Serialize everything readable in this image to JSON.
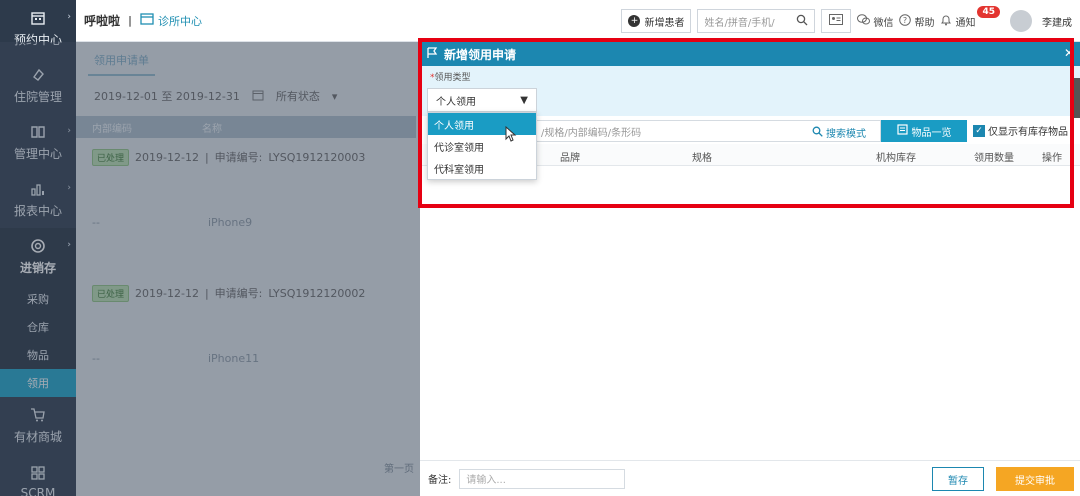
{
  "sidebar": {
    "items": [
      {
        "label": "预约中心",
        "icon": "calendar-icon"
      },
      {
        "label": "住院管理",
        "icon": "hospital-icon"
      },
      {
        "label": "管理中心",
        "icon": "book-icon"
      },
      {
        "label": "报表中心",
        "icon": "bar-chart-icon"
      },
      {
        "label": "进销存",
        "icon": "inventory-icon"
      },
      {
        "label": "有材商城",
        "icon": "cart-icon"
      },
      {
        "label": "SCRM",
        "icon": "grid-icon"
      }
    ],
    "subitems": [
      "采购",
      "仓库",
      "物品",
      "领用"
    ]
  },
  "topbar": {
    "brand": "呼啦啦",
    "separator": "|",
    "clinic": "诊所中心",
    "new_patient": "新增患者",
    "search_placeholder": "姓名/拼音/手机/",
    "wechat": "微信",
    "help": "帮助",
    "notify": "通知",
    "notify_count": "45",
    "username": "李建成"
  },
  "background": {
    "tab": "领用申请单",
    "date_range": "2019-12-01 至 2019-12-31",
    "status_filter": "所有状态",
    "col_code": "内部编码",
    "col_name": "名称",
    "groups": [
      {
        "tag": "已处理",
        "date": "2019-12-12",
        "sep": "|",
        "no_label": "申请编号:",
        "no": "LYSQ1912120003",
        "code": "--",
        "name": "iPhone9"
      },
      {
        "tag": "已处理",
        "date": "2019-12-12",
        "sep": "|",
        "no_label": "申请编号:",
        "no": "LYSQ1912120002",
        "code": "--",
        "name": "iPhone11"
      }
    ],
    "pager": "第一页"
  },
  "modal": {
    "title": "新增领用申请",
    "type_label": "领用类型",
    "type_selected": "个人领用",
    "type_options": [
      "个人领用",
      "代诊室领用",
      "代科室领用"
    ],
    "search_placeholder": "/规格/内部编码/条形码",
    "search_mode": "搜索模式",
    "catalog_button": "物品一览",
    "stock_only": "仅显示有库存物品",
    "columns": [
      "品牌",
      "规格",
      "机构库存",
      "领用数量",
      "操作"
    ],
    "remark_label": "备注:",
    "remark_placeholder": "请输入...",
    "save_button": "暂存",
    "submit_button": "提交审批"
  },
  "colors": {
    "accent": "#1c87b0",
    "highlight": "#e60012",
    "submit": "#f5a623",
    "sidebar": "#2d3a4b"
  }
}
